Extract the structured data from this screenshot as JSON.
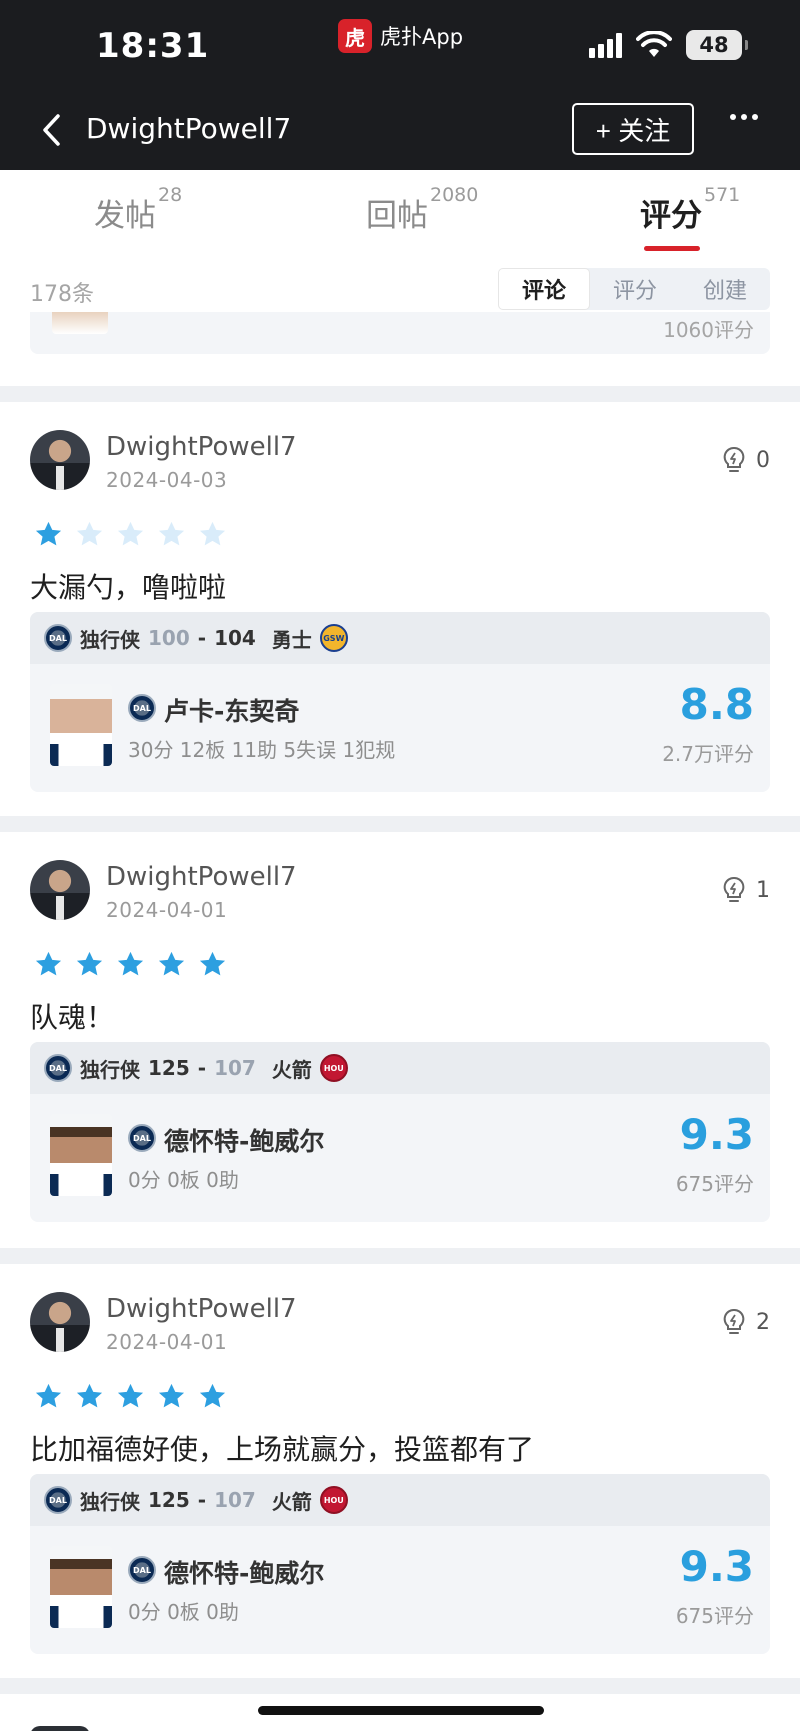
{
  "status_bar": {
    "time": "18:31",
    "app_logo_glyph": "虎",
    "app_name": "虎扑App",
    "battery": "48",
    "icons": [
      "signal-icon",
      "wifi-icon",
      "battery-icon"
    ]
  },
  "header": {
    "title": "DwightPowell7",
    "follow_label": "+ 关注",
    "back_icon": "chevron-left-icon",
    "more_icon": "more-dots-icon"
  },
  "tabs": [
    {
      "label": "发帖",
      "count": "28",
      "active": false
    },
    {
      "label": "回帖",
      "count": "2080",
      "active": false
    },
    {
      "label": "评分",
      "count": "571",
      "active": true
    }
  ],
  "filter": {
    "count_label": "178条",
    "segments": [
      "评论",
      "评分",
      "创建"
    ],
    "selected": "评论"
  },
  "partial_card": {
    "score_count": "1060评分"
  },
  "colors": {
    "accent_red": "#d8222a",
    "rating_blue": "#2a9fde",
    "star_on": "#2d9fe0",
    "star_off": "#d9ecfa"
  },
  "reviews": [
    {
      "username": "DwightPowell7",
      "date": "2024-04-03",
      "likes": "0",
      "stars": 1,
      "comment": "大漏勺，噜啦啦",
      "game": {
        "team_a": "独行侠",
        "score_a": "100",
        "score_b": "104",
        "team_b": "勇士",
        "team_a_logo": "DAL",
        "team_b_logo": "GSW",
        "winner": "b"
      },
      "player": {
        "name": "卢卡-东契奇",
        "stats": "30分 12板 11助 5失误 1犯规",
        "rating": "8.8",
        "rating_count": "2.7万评分"
      }
    },
    {
      "username": "DwightPowell7",
      "date": "2024-04-01",
      "likes": "1",
      "stars": 5,
      "comment": "队魂！",
      "game": {
        "team_a": "独行侠",
        "score_a": "125",
        "score_b": "107",
        "team_b": "火箭",
        "team_a_logo": "DAL",
        "team_b_logo": "HOU",
        "winner": "a"
      },
      "player": {
        "name": "德怀特-鲍威尔",
        "stats": "0分 0板 0助",
        "rating": "9.3",
        "rating_count": "675评分"
      }
    },
    {
      "username": "DwightPowell7",
      "date": "2024-04-01",
      "likes": "2",
      "stars": 5,
      "comment": "比加福德好使，上场就赢分，投篮都有了",
      "game": {
        "team_a": "独行侠",
        "score_a": "125",
        "score_b": "107",
        "team_b": "火箭",
        "team_a_logo": "DAL",
        "team_b_logo": "HOU",
        "winner": "a"
      },
      "player": {
        "name": "德怀特-鲍威尔",
        "stats": "0分 0板 0助",
        "rating": "9.3",
        "rating_count": "675评分"
      }
    }
  ]
}
